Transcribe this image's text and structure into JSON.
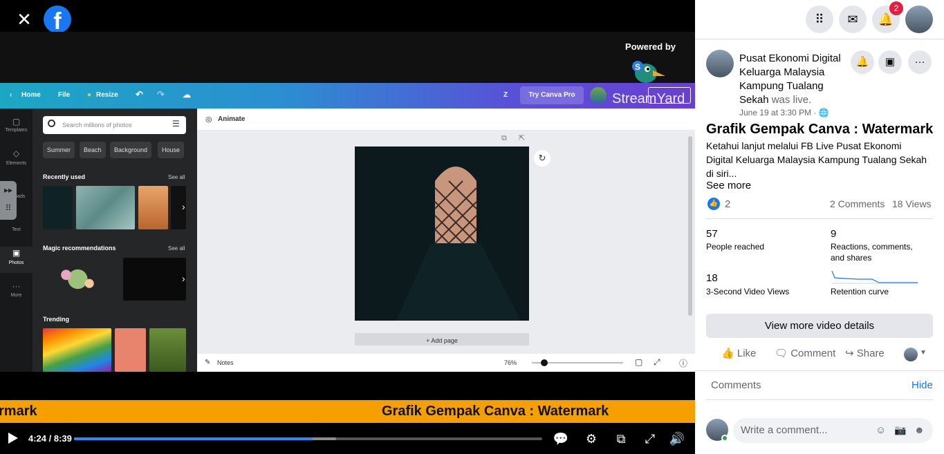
{
  "window": {
    "close_label": "✕",
    "fb_logo_letter": "f"
  },
  "stream": {
    "powered_by": "Powered by",
    "brand_text": "StreamYard"
  },
  "canva": {
    "top_nav": {
      "home": "Home",
      "file": "File",
      "resize": "Resize",
      "user_initial": "Z",
      "try_pro": "Try Canva Pro"
    },
    "rail": [
      "Templates",
      "Elements",
      "Uploads",
      "Text",
      "Photos",
      "More"
    ],
    "search_placeholder": "Search millions of photos",
    "chips": [
      "Summer",
      "Beach",
      "Background",
      "House"
    ],
    "sections": {
      "recent": "Recently used",
      "magic": "Magic recommendations",
      "trending": "Trending",
      "see_all": "See all"
    },
    "animate": "Animate",
    "add_page": "+ Add page",
    "notes": "Notes",
    "zoom": "76%"
  },
  "ticker": {
    "left_fragment": "rmark",
    "main": "Grafik Gempak Canva : Watermark"
  },
  "player": {
    "time": "4:24 / 8:39",
    "progress_fraction": 0.51,
    "buffered_fraction": 0.56
  },
  "sidebar": {
    "notifications_count": "2",
    "page_name": "Pusat Ekonomi Digital Keluarga Malaysia Kampung Tualang Sekah",
    "was_live": "was live.",
    "date": "June 19 at 3:30 PM ·",
    "video_title": "Grafik Gempak Canva : Watermark",
    "description": "Ketahui lanjut melalui FB Live Pusat Ekonomi Digital Keluarga Malaysia Kampung Tualang Sekah di siri...",
    "see_more": "See more",
    "reactions": "2",
    "comments_count": "2 Comments",
    "views": "18 Views",
    "stats": [
      {
        "value": "57",
        "label": "People reached"
      },
      {
        "value": "9",
        "label": "Reactions, comments, and shares"
      },
      {
        "value": "18",
        "label": "3-Second Video Views"
      },
      {
        "value": "",
        "label": "Retention curve"
      }
    ],
    "view_more_details": "View more video details",
    "actions": {
      "like": "Like",
      "comment": "Comment",
      "share": "Share"
    },
    "comments_header": "Comments",
    "hide": "Hide",
    "comment_placeholder": "Write a comment..."
  }
}
